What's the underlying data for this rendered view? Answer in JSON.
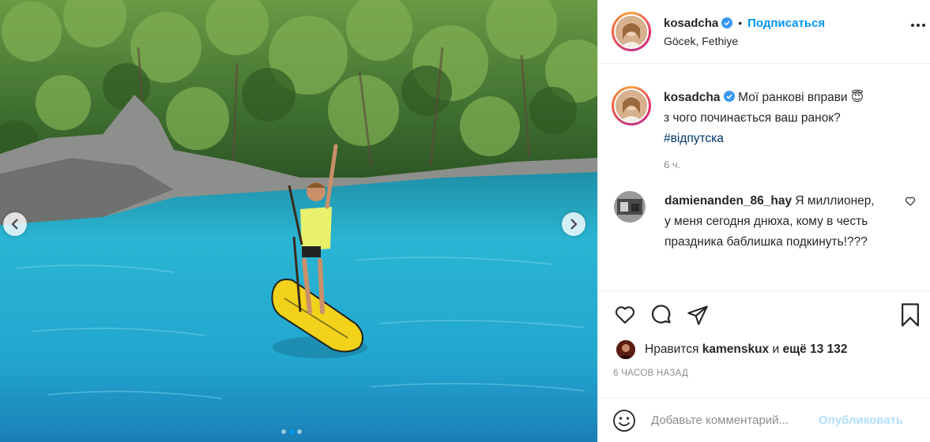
{
  "post": {
    "author": {
      "username": "kosadcha",
      "verified": true,
      "location": "Göcek, Fethiye",
      "follow_label": "Подписаться",
      "separator": "•"
    },
    "caption": {
      "username": "kosadcha",
      "text_line1": "Мої ранкові вправи 😇",
      "text_line2": "з чого починається ваш ранок?",
      "hashtag": "#відпутска",
      "time": "6 ч."
    },
    "comments": [
      {
        "username": "damienanden_86_hay",
        "text": "Я миллионер, у меня сегодня днюха, кому в честь праздника баблишка подкинуть!???"
      }
    ],
    "likes": {
      "prefix": "Нравится",
      "user": "kamenskux",
      "conjunction": "и",
      "others": "ещё 13 132"
    },
    "posted_ago": "6 ЧАСОВ НАЗАД",
    "add_comment": {
      "placeholder": "Добавьте комментарий...",
      "publish_label": "Опубликовать"
    },
    "carousel": {
      "slide_count": 3,
      "active_slide": 2
    }
  },
  "colors": {
    "accent": "#0095f6",
    "publish_disabled": "#b2dffc",
    "muted": "#8e8e8e",
    "water": "#2fb3d6",
    "board": "#f2d21a"
  },
  "icons": [
    "chevron-left-icon",
    "chevron-right-icon",
    "verified-badge-icon",
    "more-options-icon",
    "heart-icon",
    "comment-icon",
    "share-icon",
    "bookmark-icon",
    "emoji-icon"
  ]
}
